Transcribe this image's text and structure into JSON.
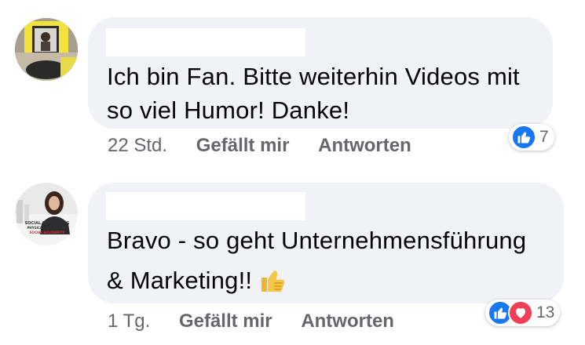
{
  "comments": [
    {
      "author_name": "",
      "text_line1": "Ich bin Fan. Bitte weiterhin Videos mit",
      "text_line2": "so viel Humor! Danke!",
      "time": "22 Std.",
      "like_label": "Gefällt mir",
      "reply_label": "Antworten",
      "reaction_count": "7",
      "reactions": [
        "like"
      ]
    },
    {
      "author_name": "",
      "text_line1": "Bravo - so geht Unternehmensführung",
      "text_line2": "& Marketing!!",
      "text_emoji": "thumbs-up-emoji",
      "time": "1 Tg.",
      "like_label": "Gefällt mir",
      "reply_label": "Antworten",
      "reaction_count": "13",
      "reactions": [
        "like",
        "love"
      ],
      "avatar_caption_1": "SOCIAL DISTANCING",
      "avatar_caption_2": "PHYSICAL DISTANCING",
      "avatar_caption_3": "SOCIAL SOLIDARITY"
    }
  ],
  "colors": {
    "bubble": "#f0f2f5",
    "text": "#050505",
    "meta": "#65676b",
    "like_blue": "#1877f2",
    "love_red": "#f33e58"
  }
}
